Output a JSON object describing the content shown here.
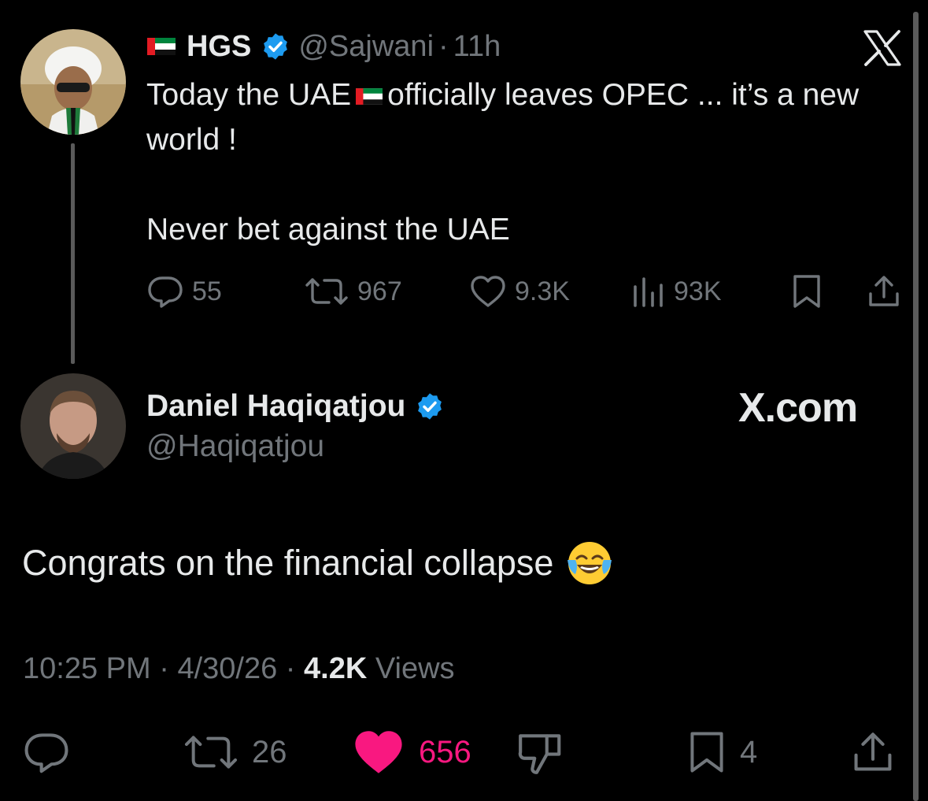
{
  "quoted_tweet": {
    "name": "HGS",
    "handle": "@Sajwani",
    "separator": "·",
    "time": "11h",
    "text_before_flag": "Today the UAE",
    "text_after_flag": "officially leaves OPEC ... it’s a new world !",
    "text_line2": "Never bet against the UAE",
    "replies": "55",
    "reposts": "967",
    "likes": "9.3K",
    "views": "93K",
    "brand_icon": "x-logo-icon"
  },
  "reply_tweet": {
    "name": "Daniel Haqiqatjou",
    "handle": "@Haqiqatjou",
    "brand_text": "X.com",
    "text": "Congrats on the financial collapse",
    "emoji": "face-with-tears-of-joy-icon",
    "time": "10:25 PM",
    "separator": "·",
    "date": "4/30/26",
    "views_count": "4.2K",
    "views_label": "Views",
    "reposts": "26",
    "likes": "656",
    "bookmarks": "4"
  },
  "colors": {
    "background": "#000000",
    "primary_text": "#e7e9ea",
    "secondary_text": "#71767b",
    "verified_blue": "#1d9bf0",
    "like_pink": "#f91880"
  }
}
